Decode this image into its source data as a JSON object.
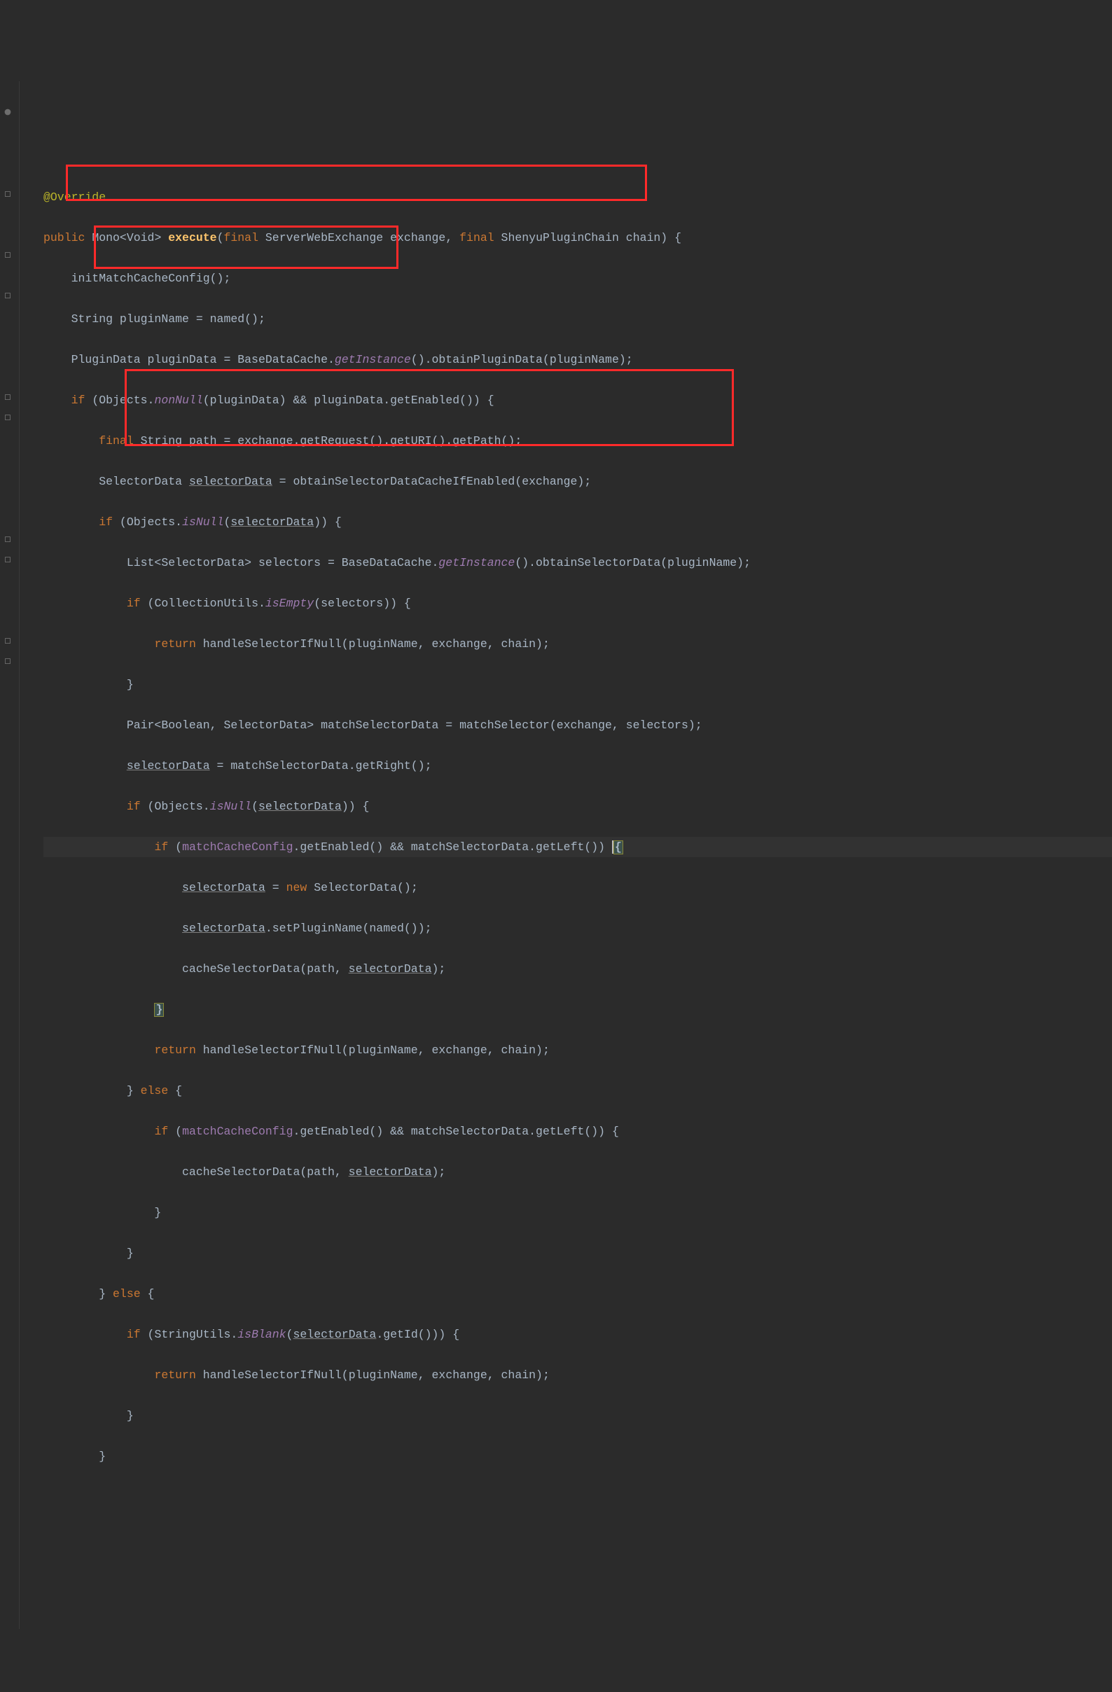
{
  "code": {
    "l1": "@Override",
    "l2_kw1": "public",
    "l2_type": " Mono<Void> ",
    "l2_meth": "execute",
    "l2_open": "(",
    "l2_kw2": "final",
    "l2_p1": " ServerWebExchange exchange, ",
    "l2_kw3": "final",
    "l2_p2": " ShenyuPluginChain chain) {",
    "l3": "    initMatchCacheConfig();",
    "l4": "    String pluginName = named();",
    "l5_a": "    PluginData pluginData = BaseDataCache.",
    "l5_b": "getInstance",
    "l5_c": "().obtainPluginData(pluginName);",
    "l6_a": "    ",
    "l6_if": "if",
    "l6_b": " (Objects.",
    "l6_c": "nonNull",
    "l6_d": "(pluginData) && pluginData.getEnabled()) {",
    "l7_a": "        ",
    "l7_kw": "final",
    "l7_b": " String path = exchange.getRequest().getURI().getPath();",
    "l8_a": "        SelectorData ",
    "l8_b": "selectorData",
    "l8_c": " = obtainSelectorDataCacheIfEnabled(exchange);",
    "l9_a": "        ",
    "l9_if": "if",
    "l9_b": " (Objects.",
    "l9_c": "isNull",
    "l9_d": "(",
    "l9_e": "selectorData",
    "l9_f": ")) {",
    "l10_a": "            List<SelectorData> selectors = BaseDataCache.",
    "l10_b": "getInstance",
    "l10_c": "().obtainSelectorData(pluginName);",
    "l11_a": "            ",
    "l11_if": "if",
    "l11_b": " (CollectionUtils.",
    "l11_c": "isEmpty",
    "l11_d": "(selectors)) {",
    "l12_a": "                ",
    "l12_kw": "return",
    "l12_b": " handleSelectorIfNull(pluginName, exchange, chain);",
    "l13": "            }",
    "l14": "            Pair<Boolean, SelectorData> matchSelectorData = matchSelector(exchange, selectors);",
    "l15_a": "            ",
    "l15_b": "selectorData",
    "l15_c": " = matchSelectorData.getRight();",
    "l16_a": "            ",
    "l16_if": "if",
    "l16_b": " (Objects.",
    "l16_c": "isNull",
    "l16_d": "(",
    "l16_e": "selectorData",
    "l16_f": ")) {",
    "l17_a": "                ",
    "l17_if": "if",
    "l17_b": " (",
    "l17_c": "matchCacheConfig",
    "l17_d": ".getEnabled() && matchSelectorData.getLeft()) ",
    "l17_e": "{",
    "l18_a": "                    ",
    "l18_b": "selectorData",
    "l18_c": " = ",
    "l18_kw": "new",
    "l18_d": " SelectorData();",
    "l19_a": "                    ",
    "l19_b": "selectorData",
    "l19_c": ".setPluginName(named());",
    "l20_a": "                    cacheSelectorData(path, ",
    "l20_b": "selectorData",
    "l20_c": ");",
    "l21_a": "                ",
    "l21_b": "}",
    "l22_a": "                ",
    "l22_kw": "return",
    "l22_b": " handleSelectorIfNull(pluginName, exchange, chain);",
    "l23_a": "            } ",
    "l23_kw": "else",
    "l23_b": " {",
    "l24_a": "                ",
    "l24_if": "if",
    "l24_b": " (",
    "l24_c": "matchCacheConfig",
    "l24_d": ".getEnabled() && matchSelectorData.getLeft()) {",
    "l25_a": "                    cacheSelectorData(path, ",
    "l25_b": "selectorData",
    "l25_c": ");",
    "l26": "                }",
    "l27": "            }",
    "l28_a": "        } ",
    "l28_kw": "else",
    "l28_b": " {",
    "l29_a": "            ",
    "l29_if": "if",
    "l29_b": " (StringUtils.",
    "l29_c": "isBlank",
    "l29_d": "(",
    "l29_e": "selectorData",
    "l29_f": ".getId())) {",
    "l30_a": "                ",
    "l30_kw": "return",
    "l30_b": " handleSelectorIfNull(pluginName, exchange, chain);",
    "l31": "            }",
    "l32": "        }"
  },
  "highlights": {
    "box1_desc": "plugin-data-null-check",
    "box2_desc": "selector-data-null-check",
    "box3_desc": "inner-null-and-cache-check"
  }
}
